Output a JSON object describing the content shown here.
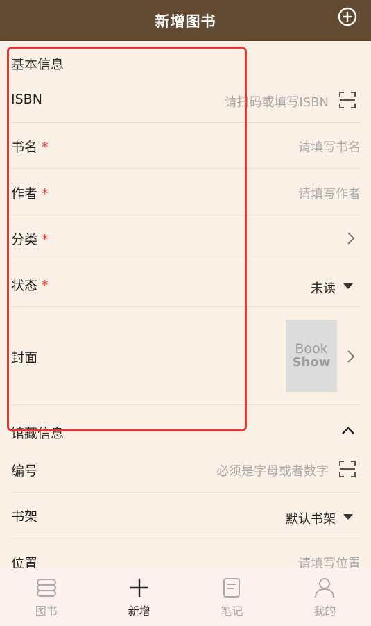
{
  "header": {
    "title": "新增图书"
  },
  "basic": {
    "title": "基本信息",
    "isbn": {
      "label": "ISBN",
      "placeholder": "请扫码或填写ISBN"
    },
    "name": {
      "label": "书名",
      "required": "*",
      "placeholder": "请填写书名"
    },
    "author": {
      "label": "作者",
      "required": "*",
      "placeholder": "请填写作者"
    },
    "category": {
      "label": "分类",
      "required": "*"
    },
    "status": {
      "label": "状态",
      "required": "*",
      "value": "未读"
    },
    "cover": {
      "label": "封面",
      "placeholder_line1": "Book",
      "placeholder_line2": "Show"
    }
  },
  "collection": {
    "title": "馆藏信息",
    "code": {
      "label": "编号",
      "placeholder": "必须是字母或者数字"
    },
    "shelf": {
      "label": "书架",
      "value": "默认书架"
    },
    "location": {
      "label": "位置",
      "placeholder": "请填写位置"
    }
  },
  "tabs": [
    {
      "label": "图书",
      "icon": "books-icon",
      "active": false
    },
    {
      "label": "新增",
      "icon": "plus-icon",
      "active": true
    },
    {
      "label": "笔记",
      "icon": "note-icon",
      "active": false
    },
    {
      "label": "我的",
      "icon": "person-icon",
      "active": false
    }
  ],
  "colors": {
    "header": "#634a32",
    "background": "#faf0e6",
    "required": "#e53935",
    "highlight": "#e53935"
  }
}
